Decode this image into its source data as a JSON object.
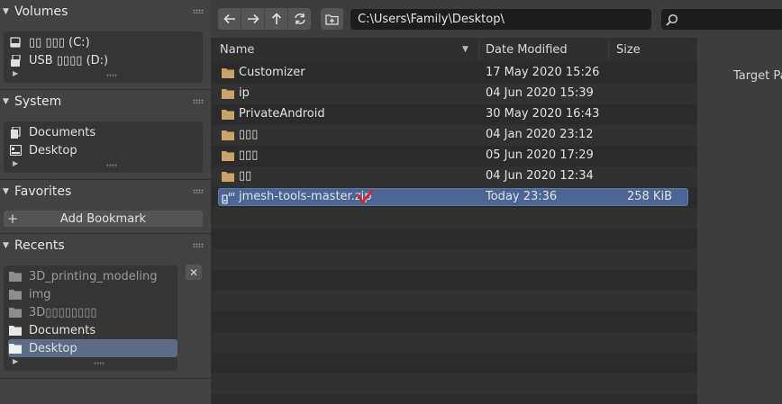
{
  "sidebar": {
    "volumes": {
      "title": "Volumes",
      "items": [
        {
          "label": "▯▯ ▯▯▯ (C:)",
          "icon": "hard-drive-icon"
        },
        {
          "label": "USB ▯▯▯▯ (D:)",
          "icon": "usb-drive-icon"
        }
      ]
    },
    "system": {
      "title": "System",
      "items": [
        {
          "label": "Documents",
          "icon": "documents-icon"
        },
        {
          "label": "Desktop",
          "icon": "desktop-icon"
        }
      ]
    },
    "favorites": {
      "title": "Favorites",
      "add_bookmark": "Add Bookmark"
    },
    "recents": {
      "title": "Recents",
      "items": [
        {
          "label": "3D_printing_modeling",
          "icon": "folder-icon"
        },
        {
          "label": "img",
          "icon": "folder-icon"
        },
        {
          "label": "3D▯▯▯▯▯▯▯▯",
          "icon": "folder-icon"
        },
        {
          "label": "Documents",
          "icon": "folder-icon"
        },
        {
          "label": "Desktop",
          "icon": "folder-icon"
        }
      ],
      "selected": "Desktop"
    }
  },
  "toolbar": {
    "path": "C:\\Users\\Family\\Desktop\\",
    "search_value": ""
  },
  "filelist": {
    "columns": {
      "name": "Name",
      "date": "Date Modified",
      "size": "Size"
    },
    "rows": [
      {
        "name": "Customizer",
        "date": "17 May 2020 15:26",
        "size": "",
        "type": "folder"
      },
      {
        "name": "ip",
        "date": "04 Jun 2020 15:39",
        "size": "",
        "type": "folder"
      },
      {
        "name": "PrivateAndroid",
        "date": "30 May 2020 16:43",
        "size": "",
        "type": "folder"
      },
      {
        "name": "▯▯▯",
        "date": "04 Jan 2020 23:12",
        "size": "",
        "type": "folder"
      },
      {
        "name": "▯▯▯",
        "date": "05 Jun 2020 17:29",
        "size": "",
        "type": "folder"
      },
      {
        "name": "▯▯",
        "date": "04 Jun 2020 12:34",
        "size": "",
        "type": "folder"
      },
      {
        "name": "jmesh-tools-master.zip",
        "date": "Today 23:36",
        "size": "258 KiB",
        "type": "zip",
        "selected": true
      }
    ]
  },
  "right_panel": {
    "target_label": "Target Pa"
  },
  "colors": {
    "selection": "#4b6594",
    "folder": "#c9a46a",
    "checkmark": "#e0202a"
  }
}
